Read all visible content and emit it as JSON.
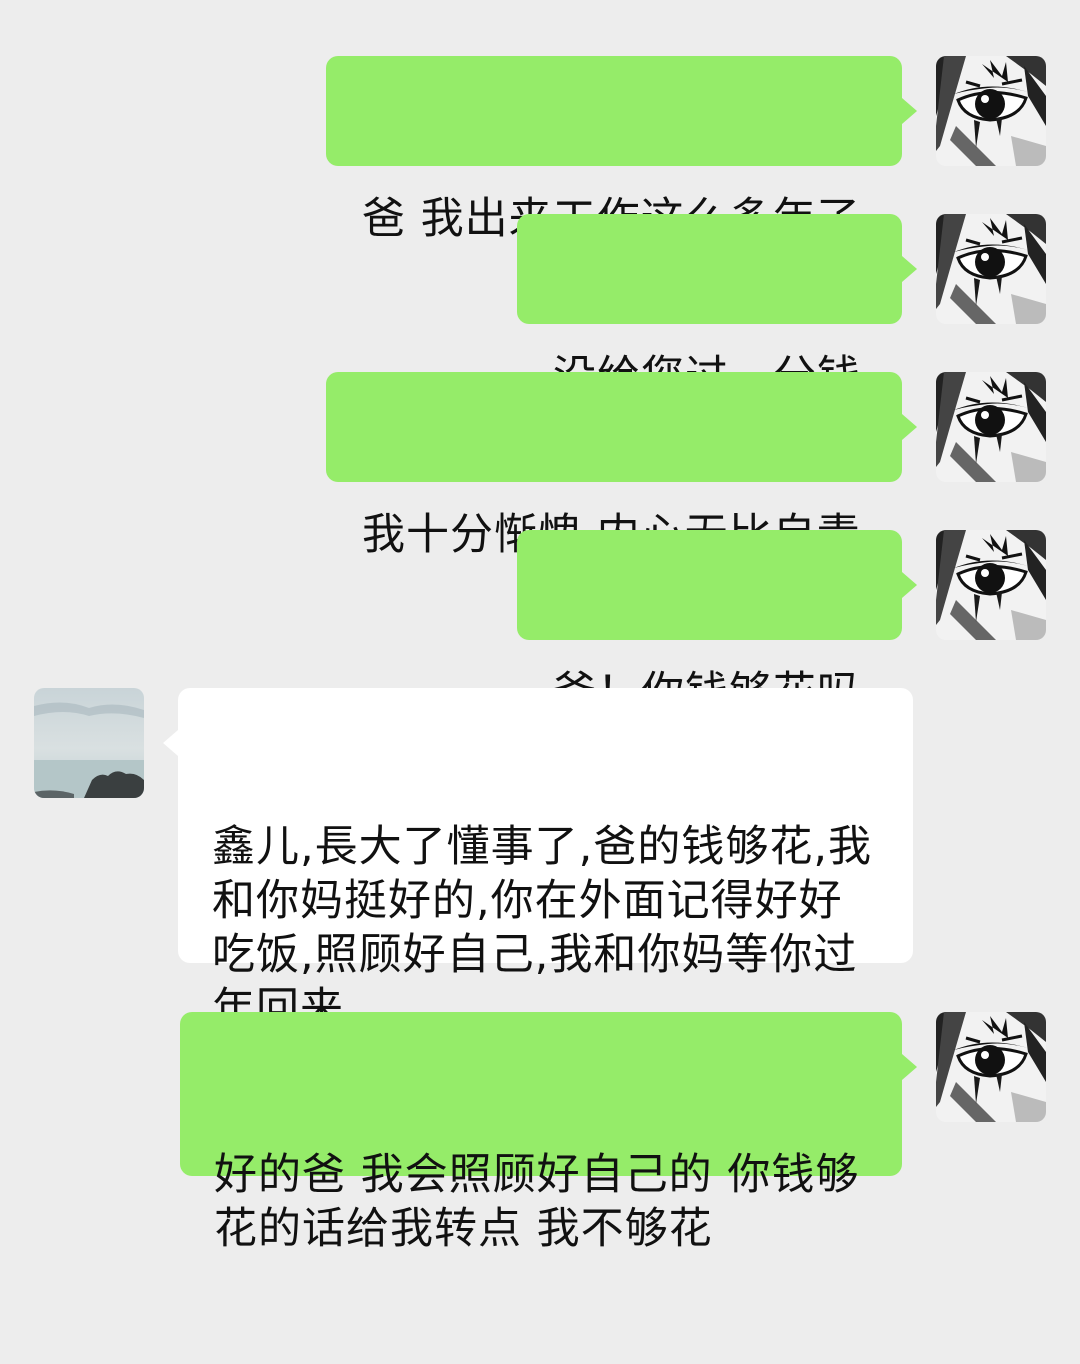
{
  "conversation": {
    "messages": [
      {
        "sender": "me",
        "text": "爸 我出来工作这么多年了"
      },
      {
        "sender": "me",
        "text": "没给您过一分钱"
      },
      {
        "sender": "me",
        "text": "我十分惭愧 内心无比自责"
      },
      {
        "sender": "me",
        "text": "爸！你钱够花吗"
      },
      {
        "sender": "dad",
        "text": "鑫儿,長大了懂事了,爸的钱够花,我和你妈挺好的,你在外面记得好好吃饭,照顾好自己,我和你妈等你过年回来"
      },
      {
        "sender": "me",
        "text": "好的爸 我会照顾好自己的 你钱够花的话给我转点 我不够花"
      }
    ]
  },
  "colors": {
    "background": "#ededed",
    "my_bubble": "#95ec69",
    "their_bubble": "#ffffff",
    "text": "#111111"
  },
  "avatars": {
    "me": "manga-eye-avatar-icon",
    "dad": "seaside-landscape-avatar-icon"
  }
}
